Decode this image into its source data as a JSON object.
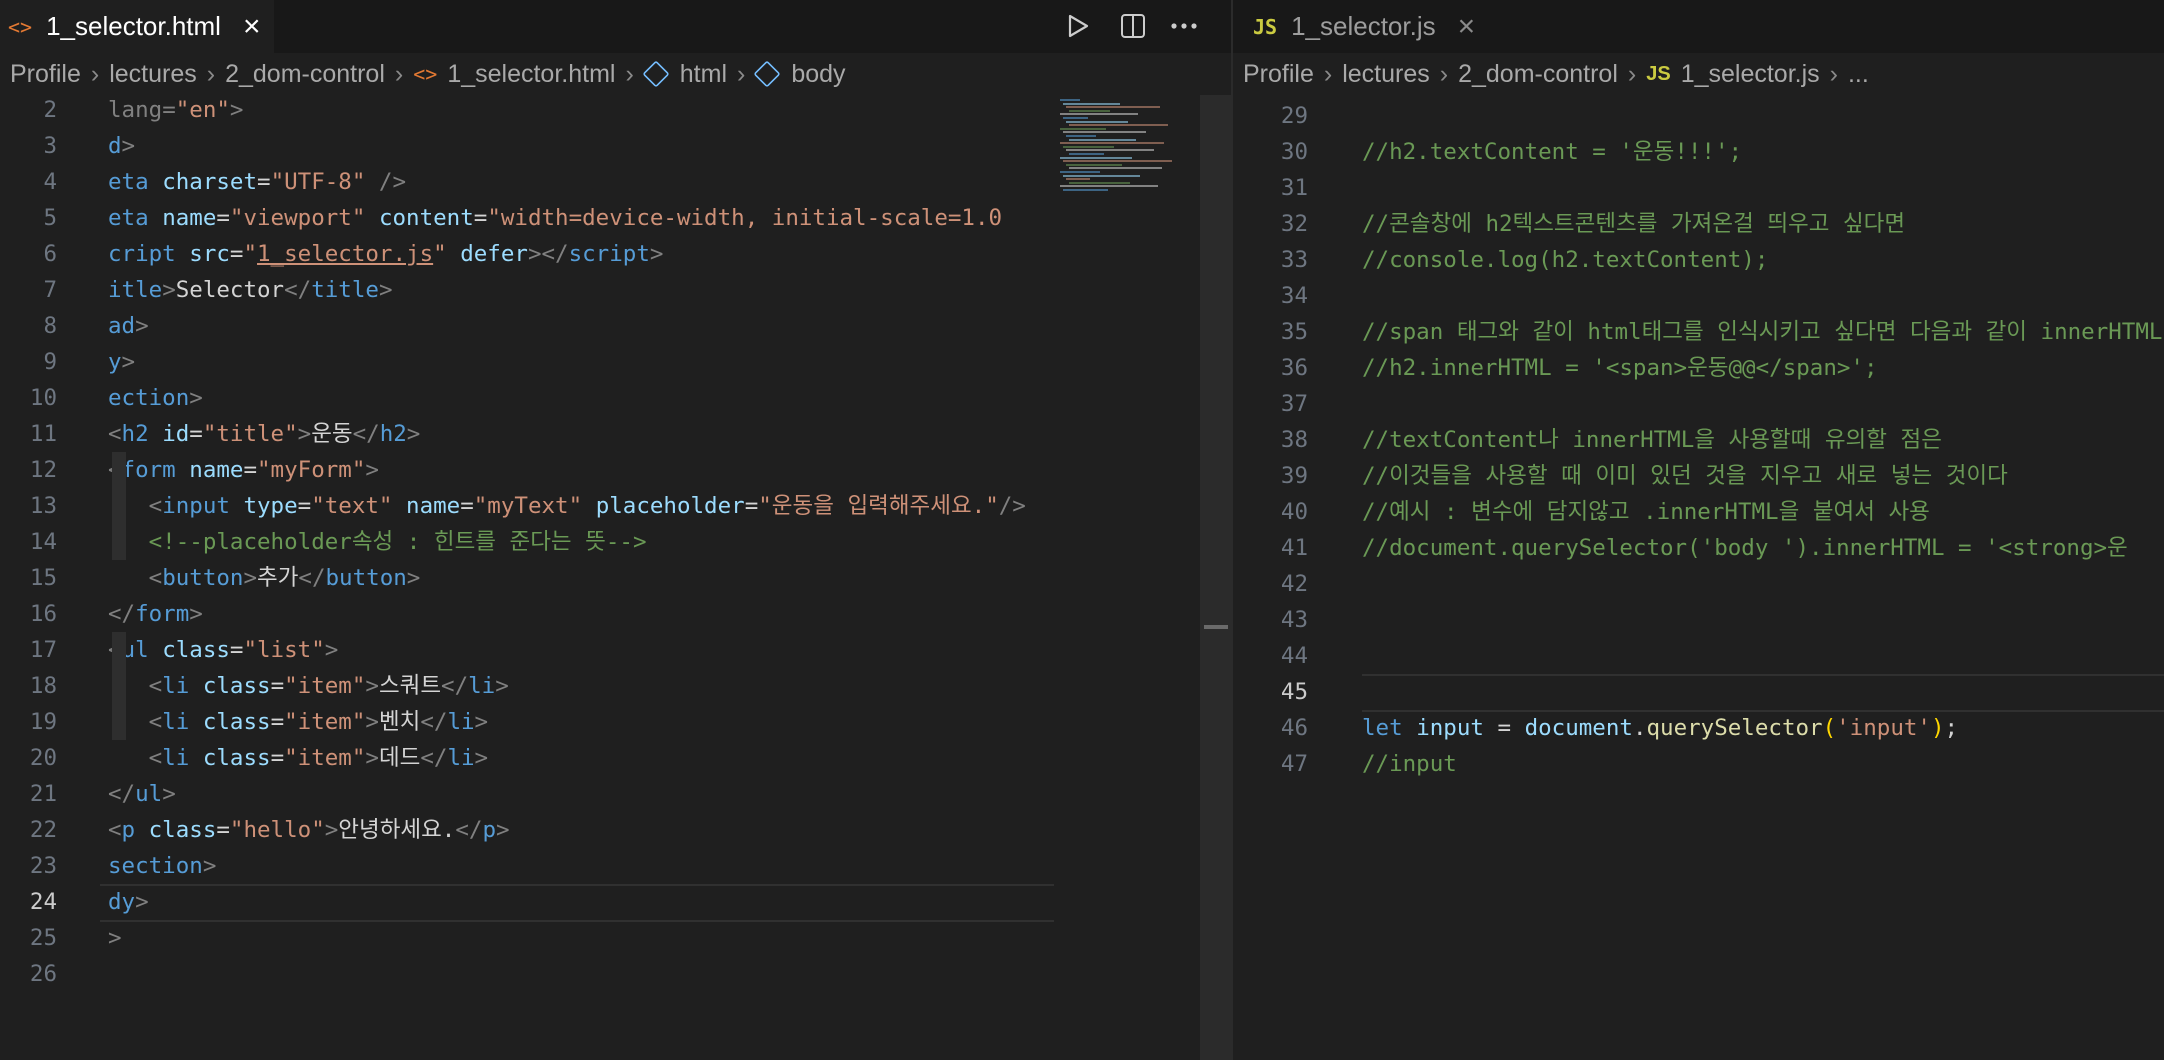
{
  "left_pane": {
    "tab": {
      "label": "1_selector.html",
      "icon": "html-file-icon"
    },
    "breadcrumb": [
      "Profile",
      "lectures",
      "2_dom-control",
      "1_selector.html",
      "html",
      "body"
    ],
    "lines": [
      {
        "n": "2",
        "tokens": [
          [
            "t-punc",
            "lang"
          ],
          [
            "t-punc",
            "="
          ],
          [
            "t-str",
            "\"en\""
          ],
          [
            "t-punc",
            ">"
          ]
        ]
      },
      {
        "n": "3",
        "tokens": [
          [
            "t-tag",
            "d"
          ],
          [
            "t-punc",
            ">"
          ]
        ]
      },
      {
        "n": "4",
        "tokens": [
          [
            "t-tag",
            "eta "
          ],
          [
            "t-attr",
            "charset"
          ],
          [
            "t-text",
            "="
          ],
          [
            "t-str",
            "\"UTF-8\""
          ],
          [
            "t-punc",
            " />"
          ]
        ]
      },
      {
        "n": "5",
        "tokens": [
          [
            "t-tag",
            "eta "
          ],
          [
            "t-attr",
            "name"
          ],
          [
            "t-text",
            "="
          ],
          [
            "t-str",
            "\"viewport\""
          ],
          [
            "t-text",
            " "
          ],
          [
            "t-attr",
            "content"
          ],
          [
            "t-text",
            "="
          ],
          [
            "t-str",
            "\"width=device-width, initial-scale=1.0"
          ]
        ]
      },
      {
        "n": "6",
        "tokens": [
          [
            "t-tag",
            "cript "
          ],
          [
            "t-attr",
            "src"
          ],
          [
            "t-text",
            "="
          ],
          [
            "t-str",
            "\""
          ],
          [
            "t-link",
            "1_selector.js"
          ],
          [
            "t-str",
            "\""
          ],
          [
            "t-text",
            " "
          ],
          [
            "t-attr",
            "defer"
          ],
          [
            "t-punc",
            "></"
          ],
          [
            "t-tag",
            "script"
          ],
          [
            "t-punc",
            ">"
          ]
        ]
      },
      {
        "n": "7",
        "tokens": [
          [
            "t-tag",
            "itle"
          ],
          [
            "t-punc",
            ">"
          ],
          [
            "t-text",
            "Selector"
          ],
          [
            "t-punc",
            "</"
          ],
          [
            "t-tag",
            "title"
          ],
          [
            "t-punc",
            ">"
          ]
        ]
      },
      {
        "n": "8",
        "tokens": [
          [
            "t-tag",
            "ad"
          ],
          [
            "t-punc",
            ">"
          ]
        ]
      },
      {
        "n": "9",
        "tokens": [
          [
            "t-tag",
            "y"
          ],
          [
            "t-punc",
            ">"
          ]
        ]
      },
      {
        "n": "10",
        "tokens": [
          [
            "t-tag",
            "ection"
          ],
          [
            "t-punc",
            ">"
          ]
        ]
      },
      {
        "n": "11",
        "tokens": [
          [
            "t-punc",
            "<"
          ],
          [
            "t-tag",
            "h2 "
          ],
          [
            "t-attr",
            "id"
          ],
          [
            "t-text",
            "="
          ],
          [
            "t-str",
            "\"title\""
          ],
          [
            "t-punc",
            ">"
          ],
          [
            "t-text",
            "운동"
          ],
          [
            "t-punc",
            "</"
          ],
          [
            "t-tag",
            "h2"
          ],
          [
            "t-punc",
            ">"
          ]
        ]
      },
      {
        "n": "12",
        "tokens": [
          [
            "t-punc",
            "<"
          ],
          [
            "t-tag",
            "form "
          ],
          [
            "t-attr",
            "name"
          ],
          [
            "t-text",
            "="
          ],
          [
            "t-str",
            "\"myForm\""
          ],
          [
            "t-punc",
            ">"
          ]
        ]
      },
      {
        "n": "13",
        "tokens": [
          [
            "t-punc",
            "   <"
          ],
          [
            "t-tag",
            "input "
          ],
          [
            "t-attr",
            "type"
          ],
          [
            "t-text",
            "="
          ],
          [
            "t-str",
            "\"text\""
          ],
          [
            "t-text",
            " "
          ],
          [
            "t-attr",
            "name"
          ],
          [
            "t-text",
            "="
          ],
          [
            "t-str",
            "\"myText\""
          ],
          [
            "t-text",
            " "
          ],
          [
            "t-attr",
            "placeholder"
          ],
          [
            "t-text",
            "="
          ],
          [
            "t-str",
            "\"운동을 입력해주세요.\""
          ],
          [
            "t-punc",
            "/>"
          ]
        ]
      },
      {
        "n": "14",
        "tokens": [
          [
            "t-cmt",
            "   <!--placeholder속성 : 힌트를 준다는 뜻-->"
          ]
        ]
      },
      {
        "n": "15",
        "tokens": [
          [
            "t-punc",
            "   <"
          ],
          [
            "t-tag",
            "button"
          ],
          [
            "t-punc",
            ">"
          ],
          [
            "t-text",
            "추가"
          ],
          [
            "t-punc",
            "</"
          ],
          [
            "t-tag",
            "button"
          ],
          [
            "t-punc",
            ">"
          ]
        ]
      },
      {
        "n": "16",
        "tokens": [
          [
            "t-punc",
            "</"
          ],
          [
            "t-tag",
            "form"
          ],
          [
            "t-punc",
            ">"
          ]
        ]
      },
      {
        "n": "17",
        "tokens": [
          [
            "t-punc",
            "<"
          ],
          [
            "t-tag",
            "ul "
          ],
          [
            "t-attr",
            "class"
          ],
          [
            "t-text",
            "="
          ],
          [
            "t-str",
            "\"list\""
          ],
          [
            "t-punc",
            ">"
          ]
        ]
      },
      {
        "n": "18",
        "tokens": [
          [
            "t-punc",
            "   <"
          ],
          [
            "t-tag",
            "li "
          ],
          [
            "t-attr",
            "class"
          ],
          [
            "t-text",
            "="
          ],
          [
            "t-str",
            "\"item\""
          ],
          [
            "t-punc",
            ">"
          ],
          [
            "t-text",
            "스쿼트"
          ],
          [
            "t-punc",
            "</"
          ],
          [
            "t-tag",
            "li"
          ],
          [
            "t-punc",
            ">"
          ]
        ]
      },
      {
        "n": "19",
        "tokens": [
          [
            "t-punc",
            "   <"
          ],
          [
            "t-tag",
            "li "
          ],
          [
            "t-attr",
            "class"
          ],
          [
            "t-text",
            "="
          ],
          [
            "t-str",
            "\"item\""
          ],
          [
            "t-punc",
            ">"
          ],
          [
            "t-text",
            "벤치"
          ],
          [
            "t-punc",
            "</"
          ],
          [
            "t-tag",
            "li"
          ],
          [
            "t-punc",
            ">"
          ]
        ]
      },
      {
        "n": "20",
        "tokens": [
          [
            "t-punc",
            "   <"
          ],
          [
            "t-tag",
            "li "
          ],
          [
            "t-attr",
            "class"
          ],
          [
            "t-text",
            "="
          ],
          [
            "t-str",
            "\"item\""
          ],
          [
            "t-punc",
            ">"
          ],
          [
            "t-text",
            "데드"
          ],
          [
            "t-punc",
            "</"
          ],
          [
            "t-tag",
            "li"
          ],
          [
            "t-punc",
            ">"
          ]
        ]
      },
      {
        "n": "21",
        "tokens": [
          [
            "t-punc",
            "</"
          ],
          [
            "t-tag",
            "ul"
          ],
          [
            "t-punc",
            ">"
          ]
        ]
      },
      {
        "n": "22",
        "tokens": [
          [
            "t-punc",
            "<"
          ],
          [
            "t-tag",
            "p "
          ],
          [
            "t-attr",
            "class"
          ],
          [
            "t-text",
            "="
          ],
          [
            "t-str",
            "\"hello\""
          ],
          [
            "t-punc",
            ">"
          ],
          [
            "t-text",
            "안녕하세요."
          ],
          [
            "t-punc",
            "</"
          ],
          [
            "t-tag",
            "p"
          ],
          [
            "t-punc",
            ">"
          ]
        ]
      },
      {
        "n": "23",
        "tokens": [
          [
            "t-tag",
            "section"
          ],
          [
            "t-punc",
            ">"
          ]
        ]
      },
      {
        "n": "24",
        "tokens": [
          [
            "t-tag",
            "dy"
          ],
          [
            "t-punc",
            ">"
          ]
        ]
      },
      {
        "n": "25",
        "tokens": [
          [
            "t-punc",
            ">"
          ]
        ]
      },
      {
        "n": "26",
        "tokens": []
      }
    ]
  },
  "right_pane": {
    "tab": {
      "label": "1_selector.js",
      "icon": "js-file-icon"
    },
    "breadcrumb": [
      "Profile",
      "lectures",
      "2_dom-control",
      "1_selector.js",
      "..."
    ],
    "lines": [
      {
        "n": "29",
        "tokens": []
      },
      {
        "n": "30",
        "tokens": [
          [
            "t-cmt",
            "//h2.textContent = '운동!!!';"
          ]
        ]
      },
      {
        "n": "31",
        "tokens": []
      },
      {
        "n": "32",
        "tokens": [
          [
            "t-cmt",
            "//콘솔창에 h2텍스트콘텐츠를 가져온걸 띄우고 싶다면"
          ]
        ]
      },
      {
        "n": "33",
        "tokens": [
          [
            "t-cmt",
            "//console.log(h2.textContent);"
          ]
        ]
      },
      {
        "n": "34",
        "tokens": []
      },
      {
        "n": "35",
        "tokens": [
          [
            "t-cmt",
            "//span 태그와 같이 html태그를 인식시키고 싶다면 다음과 같이 innerHTML"
          ]
        ]
      },
      {
        "n": "36",
        "tokens": [
          [
            "t-cmt",
            "//h2.innerHTML = '<span>운동@@</span>';"
          ]
        ]
      },
      {
        "n": "37",
        "tokens": []
      },
      {
        "n": "38",
        "tokens": [
          [
            "t-cmt",
            "//textContent나 innerHTML을 사용할때 유의할 점은"
          ]
        ]
      },
      {
        "n": "39",
        "tokens": [
          [
            "t-cmt",
            "//이것들을 사용할 때 이미 있던 것을 지우고 새로 넣는 것이다"
          ]
        ]
      },
      {
        "n": "40",
        "tokens": [
          [
            "t-cmt",
            "//예시 : 변수에 담지않고 .innerHTML을 붙여서 사용"
          ]
        ]
      },
      {
        "n": "41",
        "tokens": [
          [
            "t-cmt",
            "//document.querySelector('body ').innerHTML = '<strong>운"
          ]
        ]
      },
      {
        "n": "42",
        "tokens": []
      },
      {
        "n": "43",
        "tokens": []
      },
      {
        "n": "44",
        "tokens": []
      },
      {
        "n": "45",
        "tokens": []
      },
      {
        "n": "46",
        "tokens": [
          [
            "t-kw",
            "let "
          ],
          [
            "t-var",
            "input"
          ],
          [
            "t-text",
            " = "
          ],
          [
            "t-var",
            "document"
          ],
          [
            "t-text",
            "."
          ],
          [
            "t-fn",
            "querySelector"
          ],
          [
            "t-brk",
            "("
          ],
          [
            "t-str",
            "'input'"
          ],
          [
            "t-brk",
            ")"
          ],
          [
            "t-text",
            ";"
          ]
        ]
      },
      {
        "n": "47",
        "tokens": [
          [
            "t-cmt",
            "//input"
          ]
        ]
      }
    ]
  },
  "colors": {
    "background": "#1f1f1f",
    "tab_bar": "#181818",
    "comment": "#6a9955",
    "keyword": "#569cd6",
    "string": "#ce9178"
  }
}
